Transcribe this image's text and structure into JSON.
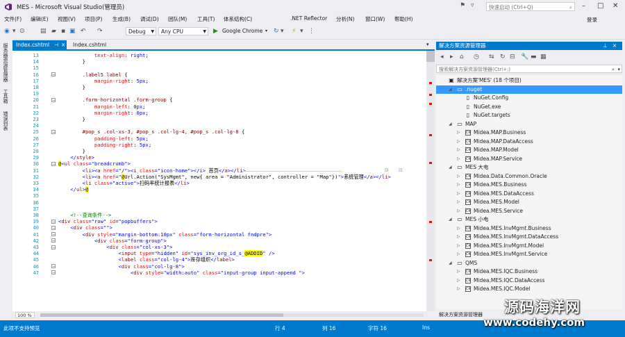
{
  "window": {
    "title": "MES - Microsoft Visual Studio(管理员)",
    "quick_launch_placeholder": "快速启动 (Ctrl+Q)",
    "login": "登录"
  },
  "menu": [
    "文件(F)",
    "编辑(E)",
    "视图(V)",
    "项目(P)",
    "生成(B)",
    "调试(D)",
    "团队(M)",
    "工具(T)",
    "体系结构(C)",
    ".NET Reflector",
    "分析(N)",
    "窗口(W)",
    "帮助(H)"
  ],
  "toolbar": {
    "config": "Debug",
    "platform": "Any CPU",
    "browser": "Google Chrome"
  },
  "left_strip": [
    "服务器资源管理器",
    "工具箱",
    "错误列表"
  ],
  "editor": {
    "tabs": [
      "Index.cshtml",
      "Index.cshtml"
    ],
    "zoom": "100 %",
    "lines": [
      {
        "n": "13",
        "seg": [
          [
            "c-prop",
            "            text-align"
          ],
          [
            "c-txt",
            ": "
          ],
          [
            "c-val",
            "right"
          ],
          [
            "c-txt",
            ";"
          ]
        ]
      },
      {
        "n": "14",
        "seg": [
          [
            "c-txt",
            "        }"
          ]
        ]
      },
      {
        "n": "15",
        "seg": [
          [
            "c-txt",
            ""
          ]
        ]
      },
      {
        "n": "16",
        "seg": [
          [
            "c-sel",
            "        .label5 label "
          ],
          [
            "c-txt",
            "{"
          ]
        ]
      },
      {
        "n": "17",
        "seg": [
          [
            "c-prop",
            "            margin-right"
          ],
          [
            "c-txt",
            ": "
          ],
          [
            "c-val",
            "5px"
          ],
          [
            "c-txt",
            ";"
          ]
        ]
      },
      {
        "n": "18",
        "seg": [
          [
            "c-txt",
            "        }"
          ]
        ]
      },
      {
        "n": "19",
        "seg": [
          [
            "c-txt",
            ""
          ]
        ]
      },
      {
        "n": "20",
        "seg": [
          [
            "c-sel",
            "        .form-horizontal .form-group "
          ],
          [
            "c-txt",
            "{"
          ]
        ]
      },
      {
        "n": "21",
        "seg": [
          [
            "c-prop",
            "            margin-left"
          ],
          [
            "c-txt",
            ": "
          ],
          [
            "c-val",
            "0px"
          ],
          [
            "c-txt",
            ";"
          ]
        ]
      },
      {
        "n": "22",
        "seg": [
          [
            "c-prop",
            "            margin-right"
          ],
          [
            "c-txt",
            ": "
          ],
          [
            "c-val",
            "0px"
          ],
          [
            "c-txt",
            ";"
          ]
        ]
      },
      {
        "n": "23",
        "seg": [
          [
            "c-txt",
            "        }"
          ]
        ]
      },
      {
        "n": "24",
        "seg": [
          [
            "c-txt",
            ""
          ]
        ]
      },
      {
        "n": "25",
        "seg": [
          [
            "c-sel",
            "        #pop_s .col-xs-3, #pop_s .col-lg-4, #pop_s .col-lg-8 "
          ],
          [
            "c-txt",
            "{"
          ]
        ]
      },
      {
        "n": "26",
        "seg": [
          [
            "c-prop",
            "            padding-left"
          ],
          [
            "c-txt",
            ": "
          ],
          [
            "c-val",
            "5px"
          ],
          [
            "c-txt",
            ";"
          ]
        ]
      },
      {
        "n": "27",
        "seg": [
          [
            "c-prop",
            "            padding-right"
          ],
          [
            "c-txt",
            ": "
          ],
          [
            "c-val",
            "5px"
          ],
          [
            "c-txt",
            ";"
          ]
        ]
      },
      {
        "n": "28",
        "seg": [
          [
            "c-txt",
            "        }"
          ]
        ]
      },
      {
        "n": "29",
        "seg": [
          [
            "c-val",
            "    </"
          ],
          [
            "c-tag",
            "style"
          ],
          [
            "c-val",
            ">"
          ]
        ]
      },
      {
        "n": "30",
        "seg": [
          [
            "razor",
            "@"
          ],
          [
            "c-val",
            "<"
          ],
          [
            "c-tag",
            "ul"
          ],
          [
            "c-attr",
            " class"
          ],
          [
            "c-val",
            "=\"breadcrumb\">"
          ]
        ]
      },
      {
        "n": "31",
        "seg": [
          [
            "c-val",
            "        <"
          ],
          [
            "c-tag",
            "li"
          ],
          [
            "c-val",
            "><"
          ],
          [
            "c-tag",
            "a"
          ],
          [
            "c-attr",
            " href"
          ],
          [
            "c-val",
            "=\"/\"><"
          ],
          [
            "c-tag",
            "i"
          ],
          [
            "c-attr",
            " class"
          ],
          [
            "c-val",
            "=\"icon-home\"></"
          ],
          [
            "c-tag",
            "i"
          ],
          [
            "c-val",
            "> "
          ],
          [
            "c-txt",
            "首页"
          ],
          [
            "c-val",
            "</"
          ],
          [
            "c-tag",
            "a"
          ],
          [
            "c-val",
            "></"
          ],
          [
            "c-tag",
            "li"
          ],
          [
            "c-val",
            ">"
          ]
        ]
      },
      {
        "n": "32",
        "seg": [
          [
            "c-val",
            "        <"
          ],
          [
            "c-tag",
            "li"
          ],
          [
            "c-val",
            "><"
          ],
          [
            "c-tag",
            "a"
          ],
          [
            "c-attr",
            " href"
          ],
          [
            "c-val",
            "=\""
          ],
          [
            "razor",
            "@"
          ],
          [
            "c-txt",
            "Url.Action(\"SysMgmt\", new{ area = \"Administrator\", controller = \"Map\"})"
          ],
          [
            "c-val",
            "\">"
          ],
          [
            "c-txt",
            "系统管理"
          ],
          [
            "c-val",
            "</"
          ],
          [
            "c-tag",
            "a"
          ],
          [
            "c-val",
            "></"
          ],
          [
            "c-tag",
            "li"
          ],
          [
            "c-val",
            ">"
          ]
        ]
      },
      {
        "n": "33",
        "seg": [
          [
            "c-val",
            "        <"
          ],
          [
            "c-tag",
            "li"
          ],
          [
            "c-attr",
            " class"
          ],
          [
            "c-val",
            "=\"active\">"
          ],
          [
            "c-txt",
            "扫码率统计报表"
          ],
          [
            "c-val",
            "</"
          ],
          [
            "c-tag",
            "li"
          ],
          [
            "c-val",
            ">"
          ]
        ]
      },
      {
        "n": "34",
        "seg": [
          [
            "c-val",
            "    </"
          ],
          [
            "c-tag",
            "ul"
          ],
          [
            "c-val",
            ">"
          ],
          [
            "razor",
            "@"
          ]
        ]
      },
      {
        "n": "35",
        "seg": [
          [
            "c-txt",
            ""
          ]
        ]
      },
      {
        "n": "36",
        "seg": [
          [
            "c-txt",
            ""
          ]
        ]
      },
      {
        "n": "37",
        "seg": [
          [
            "c-txt",
            ""
          ]
        ]
      },
      {
        "n": "38",
        "seg": [
          [
            "c-com",
            "    <!--查询条件-->"
          ]
        ]
      },
      {
        "n": "39",
        "seg": [
          [
            "c-val",
            "<"
          ],
          [
            "c-tag",
            "div"
          ],
          [
            "c-attr",
            " class"
          ],
          [
            "c-val",
            "=\"row\""
          ],
          [
            "c-attr",
            " id"
          ],
          [
            "c-val",
            "=\"popbuffers\">"
          ]
        ]
      },
      {
        "n": "40",
        "seg": [
          [
            "c-val",
            "    <"
          ],
          [
            "c-tag",
            "div"
          ],
          [
            "c-attr",
            " class"
          ],
          [
            "c-val",
            "=\"\">"
          ]
        ]
      },
      {
        "n": "41",
        "seg": [
          [
            "c-val",
            "        <"
          ],
          [
            "c-tag",
            "div"
          ],
          [
            "c-attr",
            " style"
          ],
          [
            "c-val",
            "=\"margin-bottom:10px\""
          ],
          [
            "c-attr",
            " class"
          ],
          [
            "c-val",
            "=\"form-horizontal fndpre\">"
          ]
        ]
      },
      {
        "n": "42",
        "seg": [
          [
            "c-val",
            "            <"
          ],
          [
            "c-tag",
            "div"
          ],
          [
            "c-attr",
            " class"
          ],
          [
            "c-val",
            "=\"form-group\">"
          ]
        ]
      },
      {
        "n": "43",
        "seg": [
          [
            "c-val",
            "                <"
          ],
          [
            "c-tag",
            "div"
          ],
          [
            "c-attr",
            " class"
          ],
          [
            "c-val",
            "=\"col-xs-3\">"
          ]
        ]
      },
      {
        "n": "44",
        "seg": [
          [
            "c-val",
            "                    <"
          ],
          [
            "c-tag",
            "input"
          ],
          [
            "c-attr",
            " type"
          ],
          [
            "c-val",
            "=\"hidden\""
          ],
          [
            "c-attr",
            " id"
          ],
          [
            "c-val",
            "=\"sys_inv_org_id_s_"
          ],
          [
            "razor",
            "@ADDID"
          ],
          [
            "c-val",
            "\" />"
          ]
        ]
      },
      {
        "n": "45",
        "seg": [
          [
            "c-val",
            "                    <"
          ],
          [
            "c-tag",
            "label"
          ],
          [
            "c-attr",
            " class"
          ],
          [
            "c-val",
            "=\"col-lg-4\">"
          ],
          [
            "c-txt",
            "库存组织"
          ],
          [
            "c-val",
            "</"
          ],
          [
            "c-tag",
            "label"
          ],
          [
            "c-val",
            ">"
          ]
        ]
      },
      {
        "n": "46",
        "seg": [
          [
            "c-val",
            "                    <"
          ],
          [
            "c-tag",
            "div"
          ],
          [
            "c-attr",
            " class"
          ],
          [
            "c-val",
            "=\"col-lg-8\">"
          ]
        ]
      },
      {
        "n": "47",
        "seg": [
          [
            "c-val",
            "                        <"
          ],
          [
            "c-tag",
            "div"
          ],
          [
            "c-attr",
            " style"
          ],
          [
            "c-val",
            "=\"width:auto\""
          ],
          [
            "c-attr",
            " class"
          ],
          [
            "c-val",
            "=\"input-group input-append \">"
          ]
        ]
      }
    ]
  },
  "solution_explorer": {
    "title": "解决方案资源管理器",
    "search_placeholder": "搜索解决方案资源管理器(Ctrl+;)",
    "items": [
      {
        "label": "解决方案'MES' (18 个项目)",
        "lvl": 0,
        "exp": "",
        "icon": "solution-icon",
        "glyph": "▣"
      },
      {
        "label": ".nuget",
        "lvl": 1,
        "exp": "◢",
        "icon": "folder-icon",
        "glyph": "▭",
        "sel": true
      },
      {
        "label": "NuGet.Config",
        "lvl": 2,
        "exp": "",
        "icon": "file-icon",
        "glyph": "▯"
      },
      {
        "label": "NuGet.exe",
        "lvl": 2,
        "exp": "",
        "icon": "file-icon",
        "glyph": "▯"
      },
      {
        "label": "NuGet.targets",
        "lvl": 2,
        "exp": "",
        "icon": "file-icon",
        "glyph": "▯"
      },
      {
        "label": "MAP",
        "lvl": 1,
        "exp": "◢",
        "icon": "folder-icon",
        "glyph": "▭"
      },
      {
        "label": "Midea.MAP.Business",
        "lvl": 2,
        "exp": "▷",
        "icon": "project-icon",
        "glyph": "C#"
      },
      {
        "label": "Midea.MAP.DataAccess",
        "lvl": 2,
        "exp": "▷",
        "icon": "project-icon",
        "glyph": "C#"
      },
      {
        "label": "Midea.MAP.Model",
        "lvl": 2,
        "exp": "▷",
        "icon": "project-icon",
        "glyph": "C#"
      },
      {
        "label": "Midea.MAP.Service",
        "lvl": 2,
        "exp": "▷",
        "icon": "project-icon",
        "glyph": "C#"
      },
      {
        "label": "MES 大电",
        "lvl": 1,
        "exp": "◢",
        "icon": "folder-icon",
        "glyph": "▭"
      },
      {
        "label": "Midea.Data.Common.Oracle",
        "lvl": 2,
        "exp": "▷",
        "icon": "project-icon",
        "glyph": "C#"
      },
      {
        "label": "Midea.MES.Business",
        "lvl": 2,
        "exp": "▷",
        "icon": "project-icon",
        "glyph": "C#"
      },
      {
        "label": "Midea.MES.DataAccess",
        "lvl": 2,
        "exp": "▷",
        "icon": "project-icon",
        "glyph": "C#"
      },
      {
        "label": "Midea.MES.Model",
        "lvl": 2,
        "exp": "▷",
        "icon": "project-icon",
        "glyph": "C#"
      },
      {
        "label": "Midea.MES.Service",
        "lvl": 2,
        "exp": "▷",
        "icon": "project-icon",
        "glyph": "C#"
      },
      {
        "label": "MES 小电",
        "lvl": 1,
        "exp": "◢",
        "icon": "folder-icon",
        "glyph": "▭"
      },
      {
        "label": "Midea.MES.InvMgmt.Business",
        "lvl": 2,
        "exp": "▷",
        "icon": "project-icon",
        "glyph": "C#"
      },
      {
        "label": "Midea.MES.InvMgmt.DataAccess",
        "lvl": 2,
        "exp": "▷",
        "icon": "project-icon",
        "glyph": "C#"
      },
      {
        "label": "Midea.MES.InvMgmt.Model",
        "lvl": 2,
        "exp": "▷",
        "icon": "project-icon",
        "glyph": "C#"
      },
      {
        "label": "Midea.MES.InvMgmt.Service",
        "lvl": 2,
        "exp": "▷",
        "icon": "project-icon",
        "glyph": "C#"
      },
      {
        "label": "QMS",
        "lvl": 1,
        "exp": "◢",
        "icon": "folder-icon",
        "glyph": "▭"
      },
      {
        "label": "Midea.MES.IQC.Business",
        "lvl": 2,
        "exp": "▷",
        "icon": "project-icon",
        "glyph": "C#"
      },
      {
        "label": "Midea.MES.IQC.DataAccess",
        "lvl": 2,
        "exp": "▷",
        "icon": "project-icon",
        "glyph": "C#"
      },
      {
        "label": "Midea.MES.IQC.Model",
        "lvl": 2,
        "exp": "▷",
        "icon": "project-icon",
        "glyph": "C#"
      }
    ],
    "bottom_tab": "解决方案资源管理器"
  },
  "status": {
    "message": "此项不支持预览",
    "line": "行 4",
    "col": "列 16",
    "char": "字符 16",
    "mode": "Ins"
  },
  "watermark": {
    "line1": "源码海洋网",
    "line2": "www.codehy.com"
  },
  "colors": {
    "accent": "#007acc",
    "selection": "#3399ff",
    "background": "#eeeef2"
  }
}
